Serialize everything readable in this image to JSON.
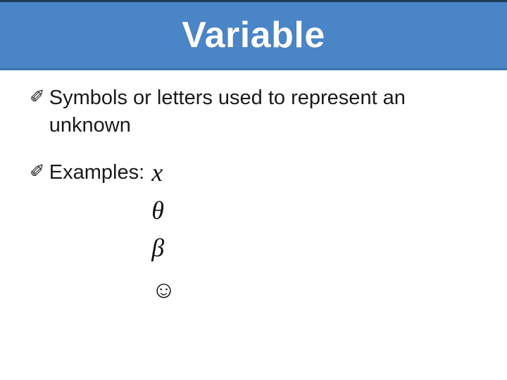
{
  "title": "Variable",
  "bullets": [
    {
      "icon": "✐",
      "text": "Symbols or letters used to represent an unknown"
    },
    {
      "icon": "✐",
      "label": "Examples:"
    }
  ],
  "examples": [
    "x",
    "θ",
    "β",
    "☺"
  ]
}
